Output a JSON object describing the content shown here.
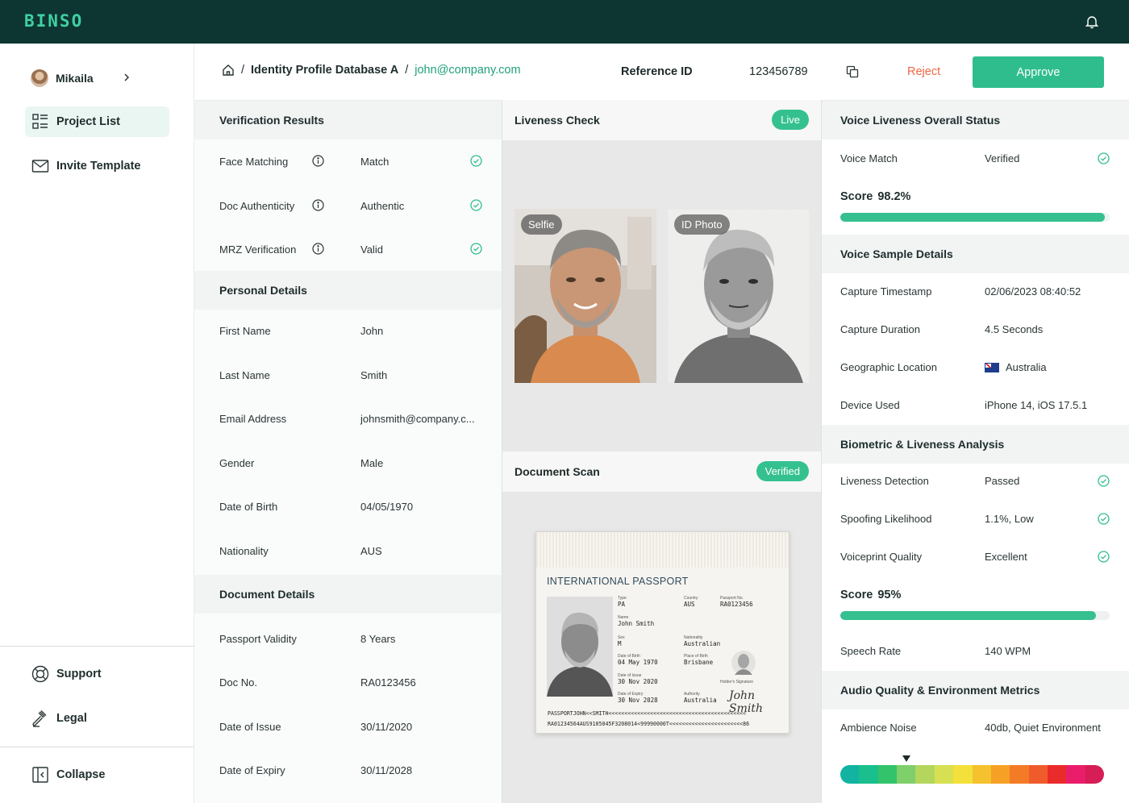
{
  "app": {
    "logo": "BINSO"
  },
  "user": {
    "name": "Mikaila"
  },
  "sidebar": {
    "items": [
      {
        "label": "Project List",
        "active": true
      },
      {
        "label": "Invite Template",
        "active": false
      }
    ],
    "bottom": [
      {
        "label": "Support"
      },
      {
        "label": "Legal"
      }
    ],
    "collapse_label": "Collapse"
  },
  "header": {
    "breadcrumb_section": "Identity Profile Database A",
    "breadcrumb_email": "john@company.com",
    "reference_label": "Reference ID",
    "reference_value": "123456789",
    "reject_label": "Reject",
    "approve_label": "Approve"
  },
  "verification": {
    "title": "Verification Results",
    "rows": [
      {
        "key": "Face Matching",
        "value": "Match"
      },
      {
        "key": "Doc Authenticity",
        "value": "Authentic"
      },
      {
        "key": "MRZ Verification",
        "value": "Valid"
      }
    ]
  },
  "personal": {
    "title": "Personal Details",
    "rows": [
      {
        "key": "First Name",
        "value": "John"
      },
      {
        "key": "Last Name",
        "value": "Smith"
      },
      {
        "key": "Email Address",
        "value": "johnsmith@company.c..."
      },
      {
        "key": "Gender",
        "value": "Male"
      },
      {
        "key": "Date of Birth",
        "value": "04/05/1970"
      },
      {
        "key": "Nationality",
        "value": "AUS"
      }
    ]
  },
  "document": {
    "title": "Document Details",
    "rows": [
      {
        "key": "Passport Validity",
        "value": "8 Years"
      },
      {
        "key": "Doc No.",
        "value": "RA0123456"
      },
      {
        "key": "Date of Issue",
        "value": "30/11/2020"
      },
      {
        "key": "Date of Expiry",
        "value": "30/11/2028"
      }
    ]
  },
  "liveness": {
    "title": "Liveness Check",
    "status": "Live",
    "selfie_label": "Selfie",
    "id_label": "ID Photo"
  },
  "doc_scan": {
    "title": "Document Scan",
    "status": "Verified",
    "passport": {
      "title": "INTERNATIONAL PASSPORT",
      "type_label": "Type",
      "type": "PA",
      "country_label": "Country",
      "country": "AUS",
      "passport_no_label": "Passport No.",
      "passport_no": "RA0123456",
      "name_label": "Name",
      "name": "John Smith",
      "sex_label": "Sex",
      "sex": "M",
      "nationality_label": "Nationality",
      "nationality": "Australian",
      "dob_label": "Date of Birth",
      "dob": "04 May 1970",
      "pob_label": "Place of Birth",
      "pob": "Brisbane",
      "issue_label": "Date of Issue",
      "issue": "30 Nov 2020",
      "signature_label": "Holder's Signature",
      "expiry_label": "Date of Expiry",
      "expiry": "30 Nov 2028",
      "authority_label": "Authority",
      "authority": "Australia",
      "signature": "John Smith",
      "mrz1": "PASSPORTJOHN<<SMITH<<<<<<<<<<<<<<<<<<<<<<<<<<<<<<<<<<<<<<<<<<<",
      "mrz2": "RA01234564AUS9105045F3208014<99990000T<<<<<<<<<<<<<<<<<<<<<<<86"
    }
  },
  "voice_status": {
    "title": "Voice Liveness Overall Status",
    "rows": [
      {
        "key": "Voice Match",
        "value": "Verified"
      }
    ],
    "score_label": "Score",
    "score_text": "98.2%",
    "score_value": 0.982
  },
  "voice_sample": {
    "title": "Voice Sample Details",
    "rows": [
      {
        "key": "Capture Timestamp",
        "value": "02/06/2023 08:40:52"
      },
      {
        "key": "Capture Duration",
        "value": "4.5 Seconds"
      },
      {
        "key": "Geographic Location",
        "value": "Australia"
      },
      {
        "key": "Device Used",
        "value": "iPhone 14, iOS 17.5.1"
      }
    ]
  },
  "biometric": {
    "title": "Biometric & Liveness Analysis",
    "rows": [
      {
        "key": "Liveness Detection",
        "value": "Passed"
      },
      {
        "key": "Spoofing Likelihood",
        "value": "1.1%, Low"
      },
      {
        "key": "Voiceprint Quality",
        "value": "Excellent"
      }
    ],
    "score_label": "Score",
    "score_text": "95%",
    "score_value": 0.95,
    "speech_rate_label": "Speech Rate",
    "speech_rate": "140 WPM"
  },
  "audio": {
    "title": "Audio Quality & Environment Metrics",
    "rows": [
      {
        "key": "Ambience Noise",
        "value": "40db, Quiet Environment"
      }
    ],
    "noise_colors": [
      "#12b3a0",
      "#19bf8c",
      "#33c36b",
      "#7fcf6b",
      "#b4d65e",
      "#d6e052",
      "#f3e03b",
      "#f6c12f",
      "#f7a026",
      "#f47b26",
      "#ef5b2b",
      "#ea2b2b",
      "#ea1d6b",
      "#d61d56"
    ],
    "noise_marker_segment": 3
  }
}
